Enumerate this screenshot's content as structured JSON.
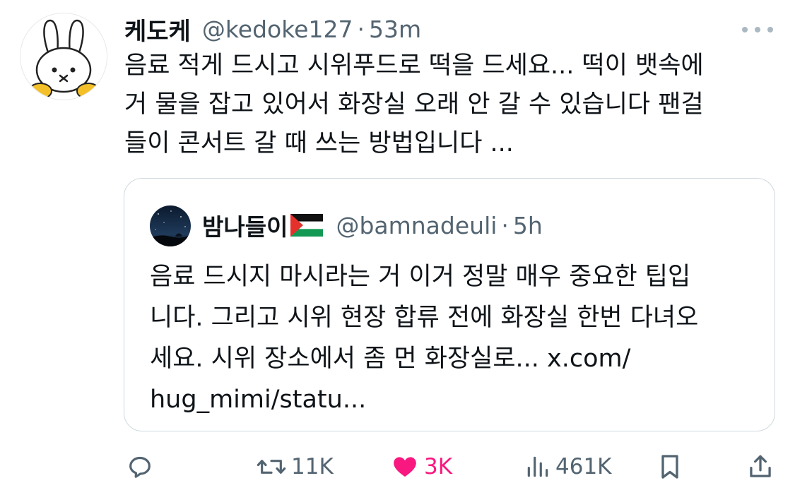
{
  "tweet": {
    "author": {
      "display_name": "케도케",
      "handle": "@kedoke127",
      "separator": "·",
      "time": "53m"
    },
    "text_lines": [
      "음료 적게 드시고 시위푸드로 떡을 드세요... 떡이 뱃속에",
      "거 물을 잡고 있어서 화장실 오래 안 갈 수 있습니다 팬걸",
      "들이 콘서트 갈 때 쓰는 방법입니다 ..."
    ],
    "quote": {
      "display_name": "밤나들이",
      "handle": "@bamnadeuli",
      "separator": "·",
      "time": "5h",
      "text_lines": [
        "음료 드시지 마시라는 거 이거 정말 매우 중요한 팁입",
        "니다. 그리고 시위 현장 합류 전에 화장실 한번 다녀오",
        "세요. 시위 장소에서 좀 먼 화장실로... x.com/",
        "hug_mimi/statu..."
      ]
    },
    "actions": {
      "reply": {
        "icon": "reply-icon",
        "count": ""
      },
      "retweet": {
        "icon": "retweet-icon",
        "count": "11K"
      },
      "like": {
        "icon": "heart-icon",
        "count": "3K",
        "active": true
      },
      "views": {
        "icon": "views-icon",
        "count": "461K"
      },
      "bookmark": {
        "icon": "bookmark-icon",
        "count": ""
      },
      "share": {
        "icon": "share-icon",
        "count": ""
      }
    },
    "colors": {
      "text": "#0f1419",
      "secondary": "#536471",
      "like": "#f91880",
      "border": "#cfd9de"
    }
  }
}
